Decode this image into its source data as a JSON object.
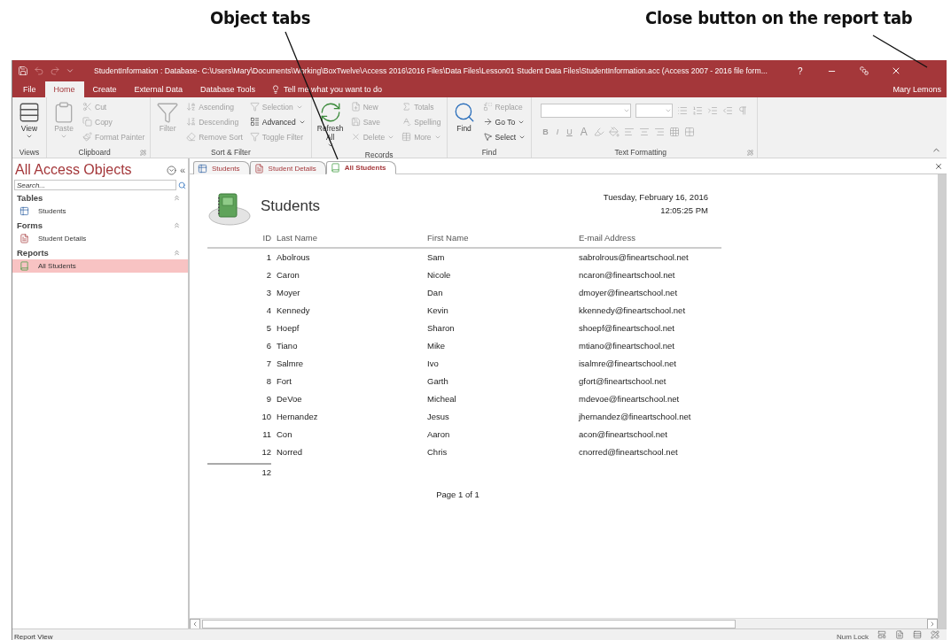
{
  "annotations": [
    {
      "text": "Object tabs"
    },
    {
      "text": "Close button on the report tab"
    }
  ],
  "window": {
    "title": "StudentInformation : Database- C:\\Users\\Mary\\Documents\\Working\\BoxTwelve\\Access 2016\\2016 Files\\Data Files\\Lesson01 Student Data Files\\StudentInformation.acc (Access 2007 - 2016 file form...",
    "help": "?",
    "user": "Mary Lemons"
  },
  "ribbon_tabs": [
    {
      "label": "File",
      "selected": false
    },
    {
      "label": "Home",
      "selected": true
    },
    {
      "label": "Create",
      "selected": false
    },
    {
      "label": "External Data",
      "selected": false
    },
    {
      "label": "Database Tools",
      "selected": false
    }
  ],
  "tell_me": "Tell me what you want to do",
  "ribbon_groups": [
    {
      "kind": "buttons",
      "name": "Views",
      "launcher": false,
      "large": [
        {
          "label": "View",
          "disabled": false,
          "menu": true
        }
      ]
    },
    {
      "kind": "buttons",
      "name": "Clipboard",
      "launcher": true,
      "large": [
        {
          "label": "Paste",
          "disabled": true,
          "menu": true
        }
      ],
      "columns": [
        [
          {
            "label": "Cut",
            "disabled": true,
            "menu": false
          },
          {
            "label": "Copy",
            "disabled": true,
            "menu": false
          },
          {
            "label": "Format Painter",
            "disabled": true,
            "menu": false
          }
        ]
      ]
    },
    {
      "kind": "buttons",
      "name": "Sort & Filter",
      "launcher": false,
      "large": [
        {
          "label": "Filter",
          "disabled": true,
          "menu": false
        }
      ],
      "columns": [
        [
          {
            "label": "Ascending",
            "disabled": true,
            "menu": false
          },
          {
            "label": "Descending",
            "disabled": true,
            "menu": false
          },
          {
            "label": "Remove Sort",
            "disabled": true,
            "menu": false
          }
        ],
        [
          {
            "label": "Selection",
            "disabled": true,
            "menu": true
          },
          {
            "label": "Advanced",
            "disabled": false,
            "menu": true
          },
          {
            "label": "Toggle Filter",
            "disabled": true,
            "menu": false
          }
        ]
      ]
    },
    {
      "kind": "buttons",
      "name": "Records",
      "launcher": false,
      "large": [
        {
          "label": "Refresh All",
          "disabled": false,
          "menu": true
        }
      ],
      "columns": [
        [
          {
            "label": "New",
            "disabled": true,
            "menu": false
          },
          {
            "label": "Save",
            "disabled": true,
            "menu": false
          },
          {
            "label": "Delete",
            "disabled": true,
            "menu": true
          }
        ],
        [
          {
            "label": "Totals",
            "disabled": true,
            "menu": false
          },
          {
            "label": "Spelling",
            "disabled": true,
            "menu": false
          },
          {
            "label": "More",
            "disabled": true,
            "menu": true
          }
        ]
      ]
    },
    {
      "kind": "buttons",
      "name": "Find",
      "launcher": false,
      "large": [
        {
          "label": "Find",
          "disabled": false,
          "menu": false
        }
      ],
      "columns": [
        [
          {
            "label": "Replace",
            "disabled": true,
            "menu": false
          },
          {
            "label": "Go To",
            "disabled": false,
            "menu": true
          },
          {
            "label": "Select",
            "disabled": false,
            "menu": true
          }
        ]
      ]
    },
    {
      "kind": "format",
      "name": "Text Formatting",
      "launcher": true,
      "letters": [
        "B",
        "I",
        "U",
        "A"
      ]
    }
  ],
  "nav_pane": {
    "title": "All Access Objects",
    "collapse": "«",
    "search": {
      "placeholder": "Search..."
    },
    "groups": [
      {
        "name": "Tables",
        "items": [
          {
            "label": "Students",
            "kind": "table",
            "selected": false
          }
        ]
      },
      {
        "name": "Forms",
        "items": [
          {
            "label": "Student Details",
            "kind": "form",
            "selected": false
          }
        ]
      },
      {
        "name": "Reports",
        "items": [
          {
            "label": "All Students",
            "kind": "report",
            "selected": true
          }
        ]
      }
    ]
  },
  "doc_tabs": [
    {
      "label": "Students",
      "kind": "table",
      "selected": false
    },
    {
      "label": "Student Details",
      "kind": "form",
      "selected": false
    },
    {
      "label": "All Students",
      "kind": "report",
      "selected": true
    }
  ],
  "report": {
    "title": "Students",
    "date": "Tuesday, February 16, 2016",
    "time": "12:05:25 PM",
    "columns": [
      "ID",
      "Last Name",
      "First Name",
      "E-mail Address"
    ],
    "rows": [
      [
        "1",
        "Abolrous",
        "Sam",
        "sabrolrous@fineartschool.net"
      ],
      [
        "2",
        "Caron",
        "Nicole",
        "ncaron@fineartschool.net"
      ],
      [
        "3",
        "Moyer",
        "Dan",
        "dmoyer@fineartschool.net"
      ],
      [
        "4",
        "Kennedy",
        "Kevin",
        "kkennedy@fineartschool.net"
      ],
      [
        "5",
        "Hoepf",
        "Sharon",
        "shoepf@fineartschool.net"
      ],
      [
        "6",
        "Tiano",
        "Mike",
        "mtiano@fineartschool.net"
      ],
      [
        "7",
        "Salmre",
        "Ivo",
        "isalmre@fineartschool.net"
      ],
      [
        "8",
        "Fort",
        "Garth",
        "gfort@fineartschool.net"
      ],
      [
        "9",
        "DeVoe",
        "Micheal",
        "mdevoe@fineartschool.net"
      ],
      [
        "10",
        "Hernandez",
        "Jesus",
        "jhernandez@fineartschool.net"
      ],
      [
        "11",
        "Con",
        "Aaron",
        "acon@fineartschool.net"
      ],
      [
        "12",
        "Norred",
        "Chris",
        "cnorred@fineartschool.net"
      ]
    ],
    "total": "12",
    "footer": "Page 1 of 1"
  },
  "status_bar": {
    "left": "Report View",
    "num_lock": "Num Lock"
  }
}
